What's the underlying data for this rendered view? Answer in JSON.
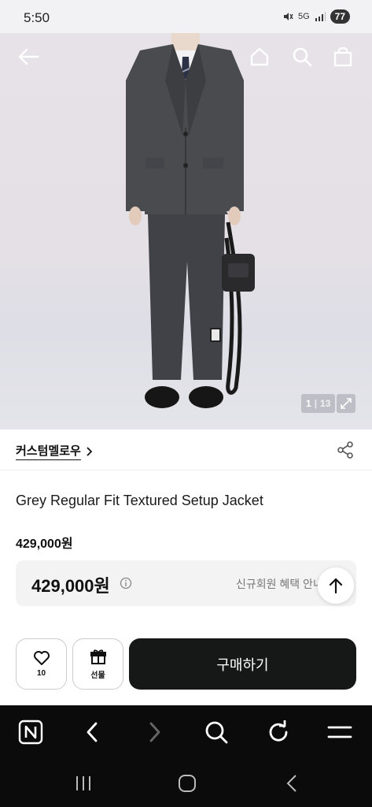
{
  "status_bar": {
    "time": "5:50",
    "network": "5G",
    "battery": "77"
  },
  "hero": {
    "image_counter_current": "1",
    "image_counter_separator": "|",
    "image_counter_total": "13",
    "icons": [
      "back-arrow-icon",
      "home-icon",
      "search-icon",
      "shopping-bag-icon",
      "expand-icon"
    ]
  },
  "product": {
    "brand": "커스텀멜로우",
    "title": "Grey Regular Fit Textured Setup Jacket",
    "price": "429,000원",
    "final_price": "429,000원",
    "benefit_link": "신규회원 혜택 안내"
  },
  "actions": {
    "like_count": "10",
    "gift_label": "선물",
    "buy_label": "구매하기"
  },
  "browser_bar": {
    "icons": [
      "naver-icon",
      "back-icon",
      "forward-icon",
      "search-icon",
      "refresh-icon",
      "menu-icon"
    ]
  },
  "system_nav": {
    "icons": [
      "recent-apps-icon",
      "home-icon",
      "back-icon"
    ]
  },
  "colors": {
    "buy_button_bg": "#161817",
    "hero_bg": "#e4e0e6",
    "nav_bg": "#0b0b0b"
  }
}
